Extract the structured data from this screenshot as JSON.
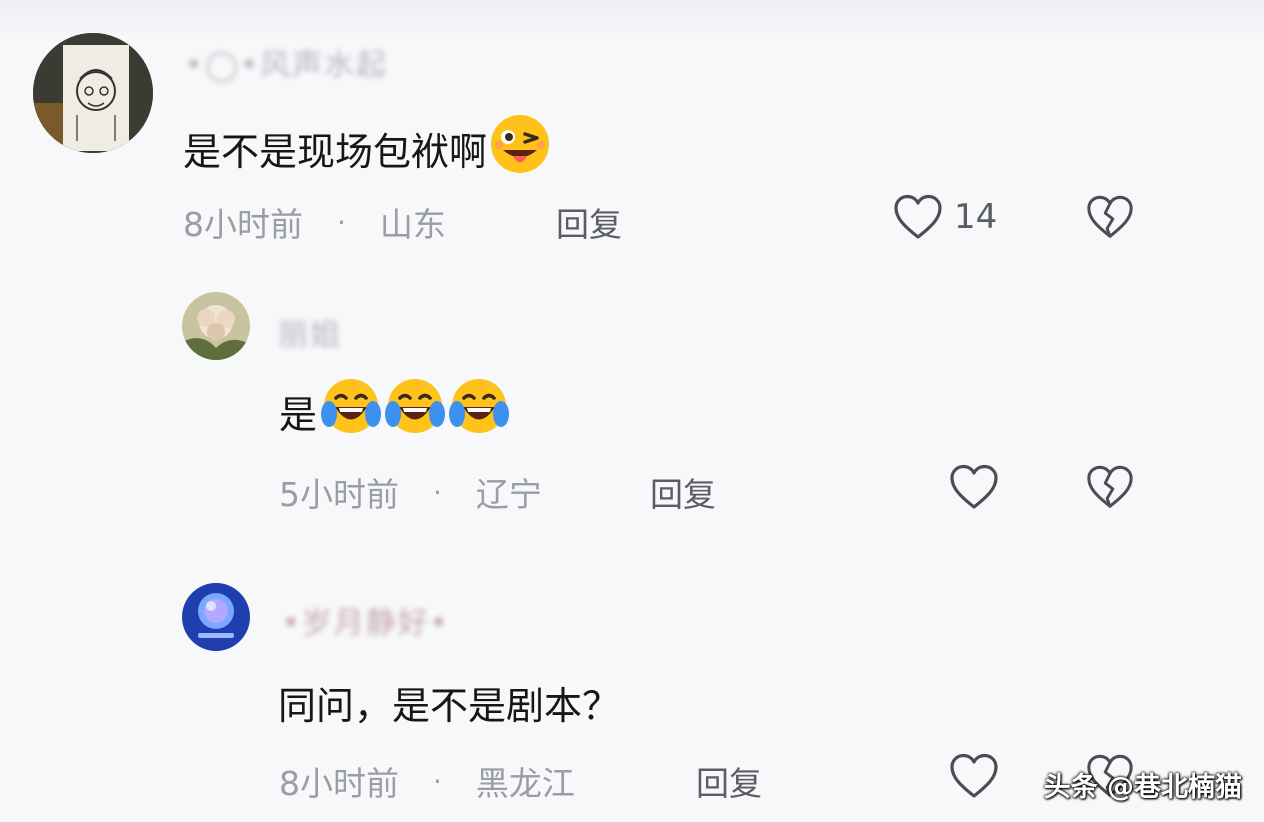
{
  "comments": [
    {
      "username": "•◯•风声水起",
      "text": "是不是现场包袱啊",
      "emoji": "wink-tongue-emoji",
      "time": "8小时前",
      "separator": "·",
      "location": "山东",
      "reply_label": "回复",
      "like_count": "14"
    },
    {
      "username": "丽姐",
      "text": "是",
      "emoji": "laugh-cry-emoji x3",
      "time": "5小时前",
      "separator": "·",
      "location": "辽宁",
      "reply_label": "回复"
    },
    {
      "username": "•岁月静好•",
      "text": "同问，是不是剧本？",
      "time": "8小时前",
      "separator": "·",
      "location": "黑龙江",
      "reply_label": "回复"
    }
  ],
  "icons": {
    "like": "heart-outline-icon",
    "dislike": "broken-heart-icon"
  },
  "colors": {
    "background": "#f7f8fa",
    "meta_text": "#9a9da2",
    "reply_text": "#5a5d62",
    "emoji_yellow": "#ffc21a"
  },
  "watermark": "头条 @巷北楠猫"
}
